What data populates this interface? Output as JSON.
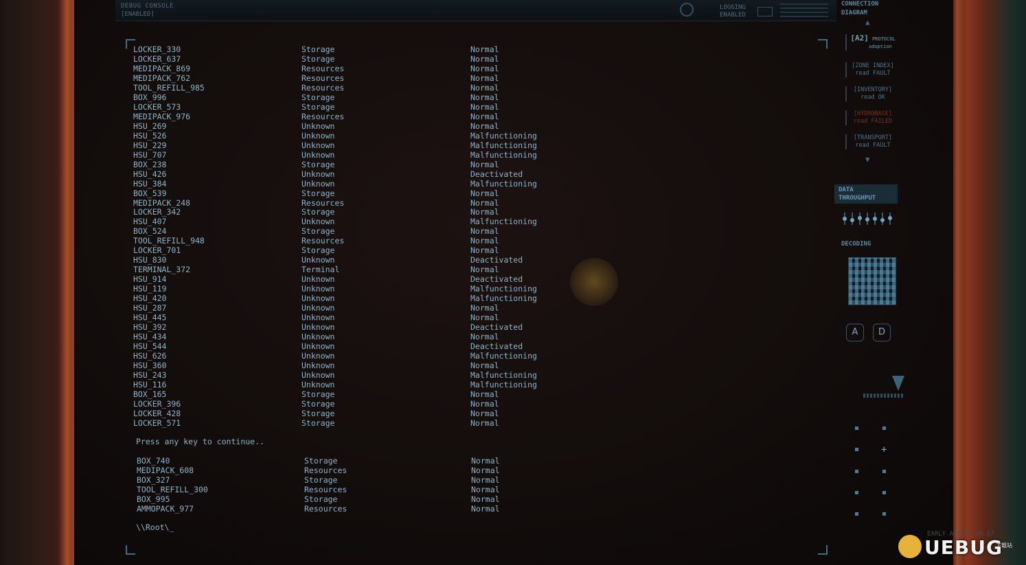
{
  "topbar": {
    "console_title": "DEBUG CONSOLE",
    "console_state": "[ENABLED]",
    "logging_line1": "LOGGING",
    "logging_line2": "ENABLED"
  },
  "listing": [
    [
      "LOCKER_330",
      "Storage",
      "Normal"
    ],
    [
      "LOCKER_637",
      "Storage",
      "Normal"
    ],
    [
      "MEDIPACK_869",
      "Resources",
      "Normal"
    ],
    [
      "MEDIPACK_762",
      "Resources",
      "Normal"
    ],
    [
      "TOOL_REFILL_985",
      "Resources",
      "Normal"
    ],
    [
      "BOX_996",
      "Storage",
      "Normal"
    ],
    [
      "LOCKER_573",
      "Storage",
      "Normal"
    ],
    [
      "MEDIPACK_976",
      "Resources",
      "Normal"
    ],
    [
      "HSU_269",
      "Unknown",
      "Normal"
    ],
    [
      "HSU_526",
      "Unknown",
      "Malfunctioning"
    ],
    [
      "HSU_229",
      "Unknown",
      "Malfunctioning"
    ],
    [
      "HSU_707",
      "Unknown",
      "Malfunctioning"
    ],
    [
      "BOX_238",
      "Storage",
      "Normal"
    ],
    [
      "HSU_426",
      "Unknown",
      "Deactivated"
    ],
    [
      "HSU_384",
      "Unknown",
      "Malfunctioning"
    ],
    [
      "BOX_539",
      "Storage",
      "Normal"
    ],
    [
      "MEDIPACK_248",
      "Resources",
      "Normal"
    ],
    [
      "LOCKER_342",
      "Storage",
      "Normal"
    ],
    [
      "HSU_407",
      "Unknown",
      "Malfunctioning"
    ],
    [
      "BOX_524",
      "Storage",
      "Normal"
    ],
    [
      "TOOL_REFILL_948",
      "Resources",
      "Normal"
    ],
    [
      "LOCKER_701",
      "Storage",
      "Normal"
    ],
    [
      "HSU_830",
      "Unknown",
      "Deactivated"
    ],
    [
      "TERMINAL_372",
      "Terminal",
      "Normal"
    ],
    [
      "HSU_914",
      "Unknown",
      "Deactivated"
    ],
    [
      "HSU_119",
      "Unknown",
      "Malfunctioning"
    ],
    [
      "HSU_420",
      "Unknown",
      "Malfunctioning"
    ],
    [
      "HSU_287",
      "Unknown",
      "Normal"
    ],
    [
      "HSU_445",
      "Unknown",
      "Normal"
    ],
    [
      "HSU_392",
      "Unknown",
      "Deactivated"
    ],
    [
      "HSU_434",
      "Unknown",
      "Normal"
    ],
    [
      "HSU_544",
      "Unknown",
      "Deactivated"
    ],
    [
      "HSU_626",
      "Unknown",
      "Malfunctioning"
    ],
    [
      "HSU_360",
      "Unknown",
      "Normal"
    ],
    [
      "HSU_243",
      "Unknown",
      "Malfunctioning"
    ],
    [
      "HSU_116",
      "Unknown",
      "Malfunctioning"
    ],
    [
      "BOX_165",
      "Storage",
      "Normal"
    ],
    [
      "LOCKER_396",
      "Storage",
      "Normal"
    ],
    [
      "LOCKER_428",
      "Storage",
      "Normal"
    ],
    [
      "LOCKER_571",
      "Storage",
      "Normal"
    ]
  ],
  "continue_prompt": "Press any key to continue..",
  "listing2": [
    [
      "BOX_740",
      "Storage",
      "Normal"
    ],
    [
      "MEDIPACK_608",
      "Resources",
      "Normal"
    ],
    [
      "BOX_327",
      "Storage",
      "Normal"
    ],
    [
      "TOOL_REFILL_300",
      "Resources",
      "Normal"
    ],
    [
      "BOX_995",
      "Storage",
      "Normal"
    ],
    [
      "AMMOPACK_977",
      "Resources",
      "Normal"
    ]
  ],
  "command_line": "\\\\Root\\_",
  "sidebar": {
    "connection_title_1": "CONNECTION",
    "connection_title_2": "DIAGRAM",
    "protocol_tag": "[A2]",
    "protocol_line1": "PROTOCOL",
    "protocol_line2": "adoption",
    "items": [
      {
        "name": "[ZONE INDEX]",
        "state": "read FAULT",
        "alert": false
      },
      {
        "name": "[INVENTORY]",
        "state": "read OK",
        "alert": false
      },
      {
        "name": "[HYDROBASE]",
        "state": "read FAILED",
        "alert": true
      },
      {
        "name": "[TRANSPORT]",
        "state": "read FAULT",
        "alert": false
      }
    ],
    "throughput_1": "DATA",
    "throughput_2": "THROUGHPUT",
    "throughput_levels": [
      0.5,
      0.3,
      0.6,
      0.4,
      0.5,
      0.35,
      0.55
    ],
    "decoding_label": "DECODING",
    "btn_a": "A",
    "btn_d": "D"
  },
  "watermark": {
    "text": "UEBUG",
    "sub": "下载站"
  },
  "version": "EARLY ACCESS v0.57"
}
